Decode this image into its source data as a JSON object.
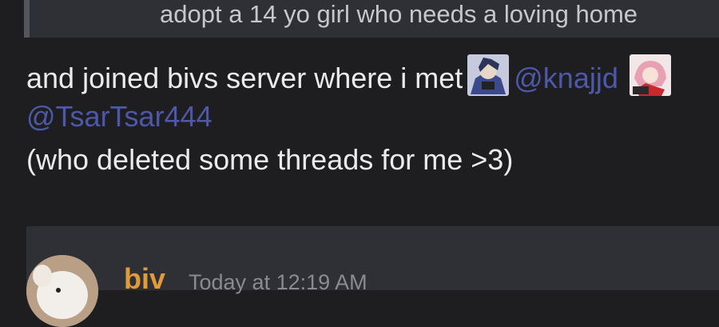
{
  "quoted": {
    "text": "adopt a 14 yo girl who needs a loving home"
  },
  "message": {
    "line1_text": "and joined bivs server where i met",
    "mention1": "@knajjd",
    "mention2": "@TsarTsar444",
    "line3_text": "(who deleted some threads for me >3)"
  },
  "next_message": {
    "username": "biv",
    "timestamp": "Today at 12:19 AM"
  },
  "colors": {
    "background": "#1e1e21",
    "quote_background": "#2e3036",
    "mention": "#4d59a8",
    "username": "#e09c3a"
  },
  "icons": {
    "avatar_knajjd": "anime-boy-avatar",
    "avatar_tsartsar": "anime-girl-avatar",
    "avatar_biv": "user-avatar"
  }
}
